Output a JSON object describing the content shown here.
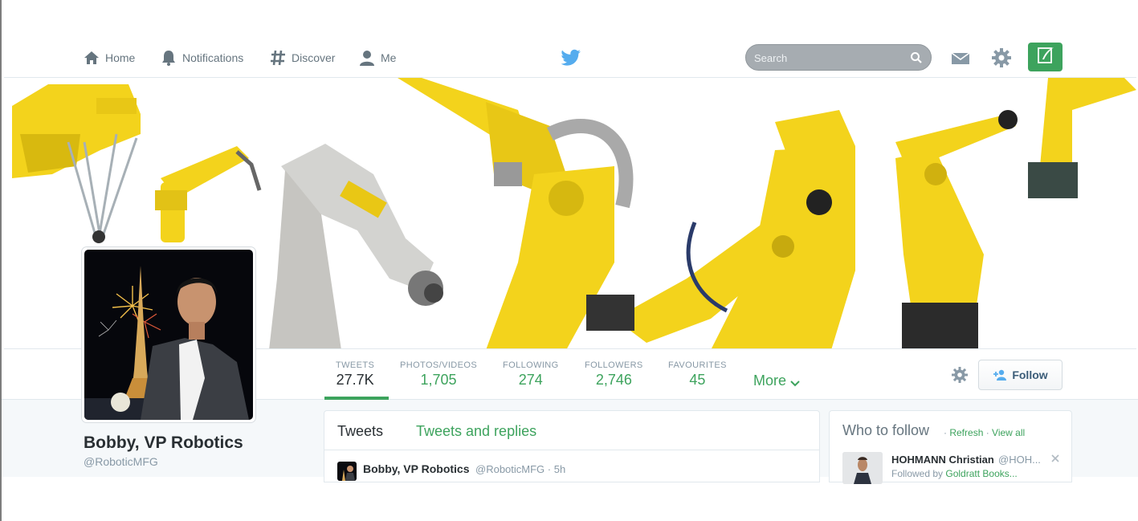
{
  "nav": {
    "home": "Home",
    "notifications": "Notifications",
    "discover": "Discover",
    "me": "Me",
    "search_placeholder": "Search"
  },
  "profile": {
    "name": "Bobby, VP Robotics",
    "handle": "@RoboticMFG"
  },
  "stats": {
    "tweets_label": "TWEETS",
    "tweets_value": "27.7K",
    "photos_label": "PHOTOS/VIDEOS",
    "photos_value": "1,705",
    "following_label": "FOLLOWING",
    "following_value": "274",
    "followers_label": "FOLLOWERS",
    "followers_value": "2,746",
    "favourites_label": "FAVOURITES",
    "favourites_value": "45",
    "more_label": "More"
  },
  "actions": {
    "follow_label": "Follow"
  },
  "timeline": {
    "tab_tweets": "Tweets",
    "tab_replies": "Tweets and replies",
    "tweet": {
      "author": "Bobby, VP Robotics",
      "meta": "@RoboticMFG · 5h"
    }
  },
  "who_to_follow": {
    "title": "Who to follow",
    "sep1": " · ",
    "refresh": "Refresh",
    "sep2": " · ",
    "view_all": "View all",
    "suggestion": {
      "name": "HOHMANN Christian",
      "handle": "@HOH...",
      "followed_by_prefix": "Followed by ",
      "followed_by": "Goldratt Books..."
    }
  },
  "colors": {
    "accent": "#3da35d",
    "robot_yellow": "#f3d31c",
    "text_muted": "#8899a6"
  },
  "icons": {
    "home": "home-icon",
    "notifications": "bell-icon",
    "discover": "hashtag-icon",
    "me": "person-icon",
    "brand": "twitter-bird-icon",
    "search": "search-icon",
    "messages": "envelope-icon",
    "settings": "gear-icon",
    "compose": "compose-quill-icon"
  }
}
